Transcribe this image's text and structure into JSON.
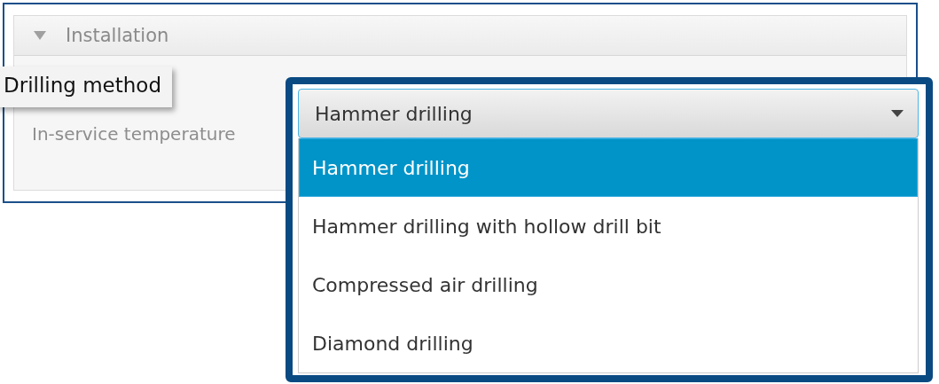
{
  "section": {
    "title": "Installation",
    "expanded": true
  },
  "fields": [
    {
      "label": "Drilling method",
      "kind": "callout"
    },
    {
      "label": "In-service temperature",
      "kind": "plain"
    }
  ],
  "dropdown": {
    "value": "Hammer drilling",
    "options": [
      {
        "label": "Hammer drilling",
        "selected": true
      },
      {
        "label": "Hammer drilling with hollow drill bit",
        "selected": false
      },
      {
        "label": "Compressed air drilling",
        "selected": false
      },
      {
        "label": "Diamond drilling",
        "selected": false
      }
    ]
  }
}
